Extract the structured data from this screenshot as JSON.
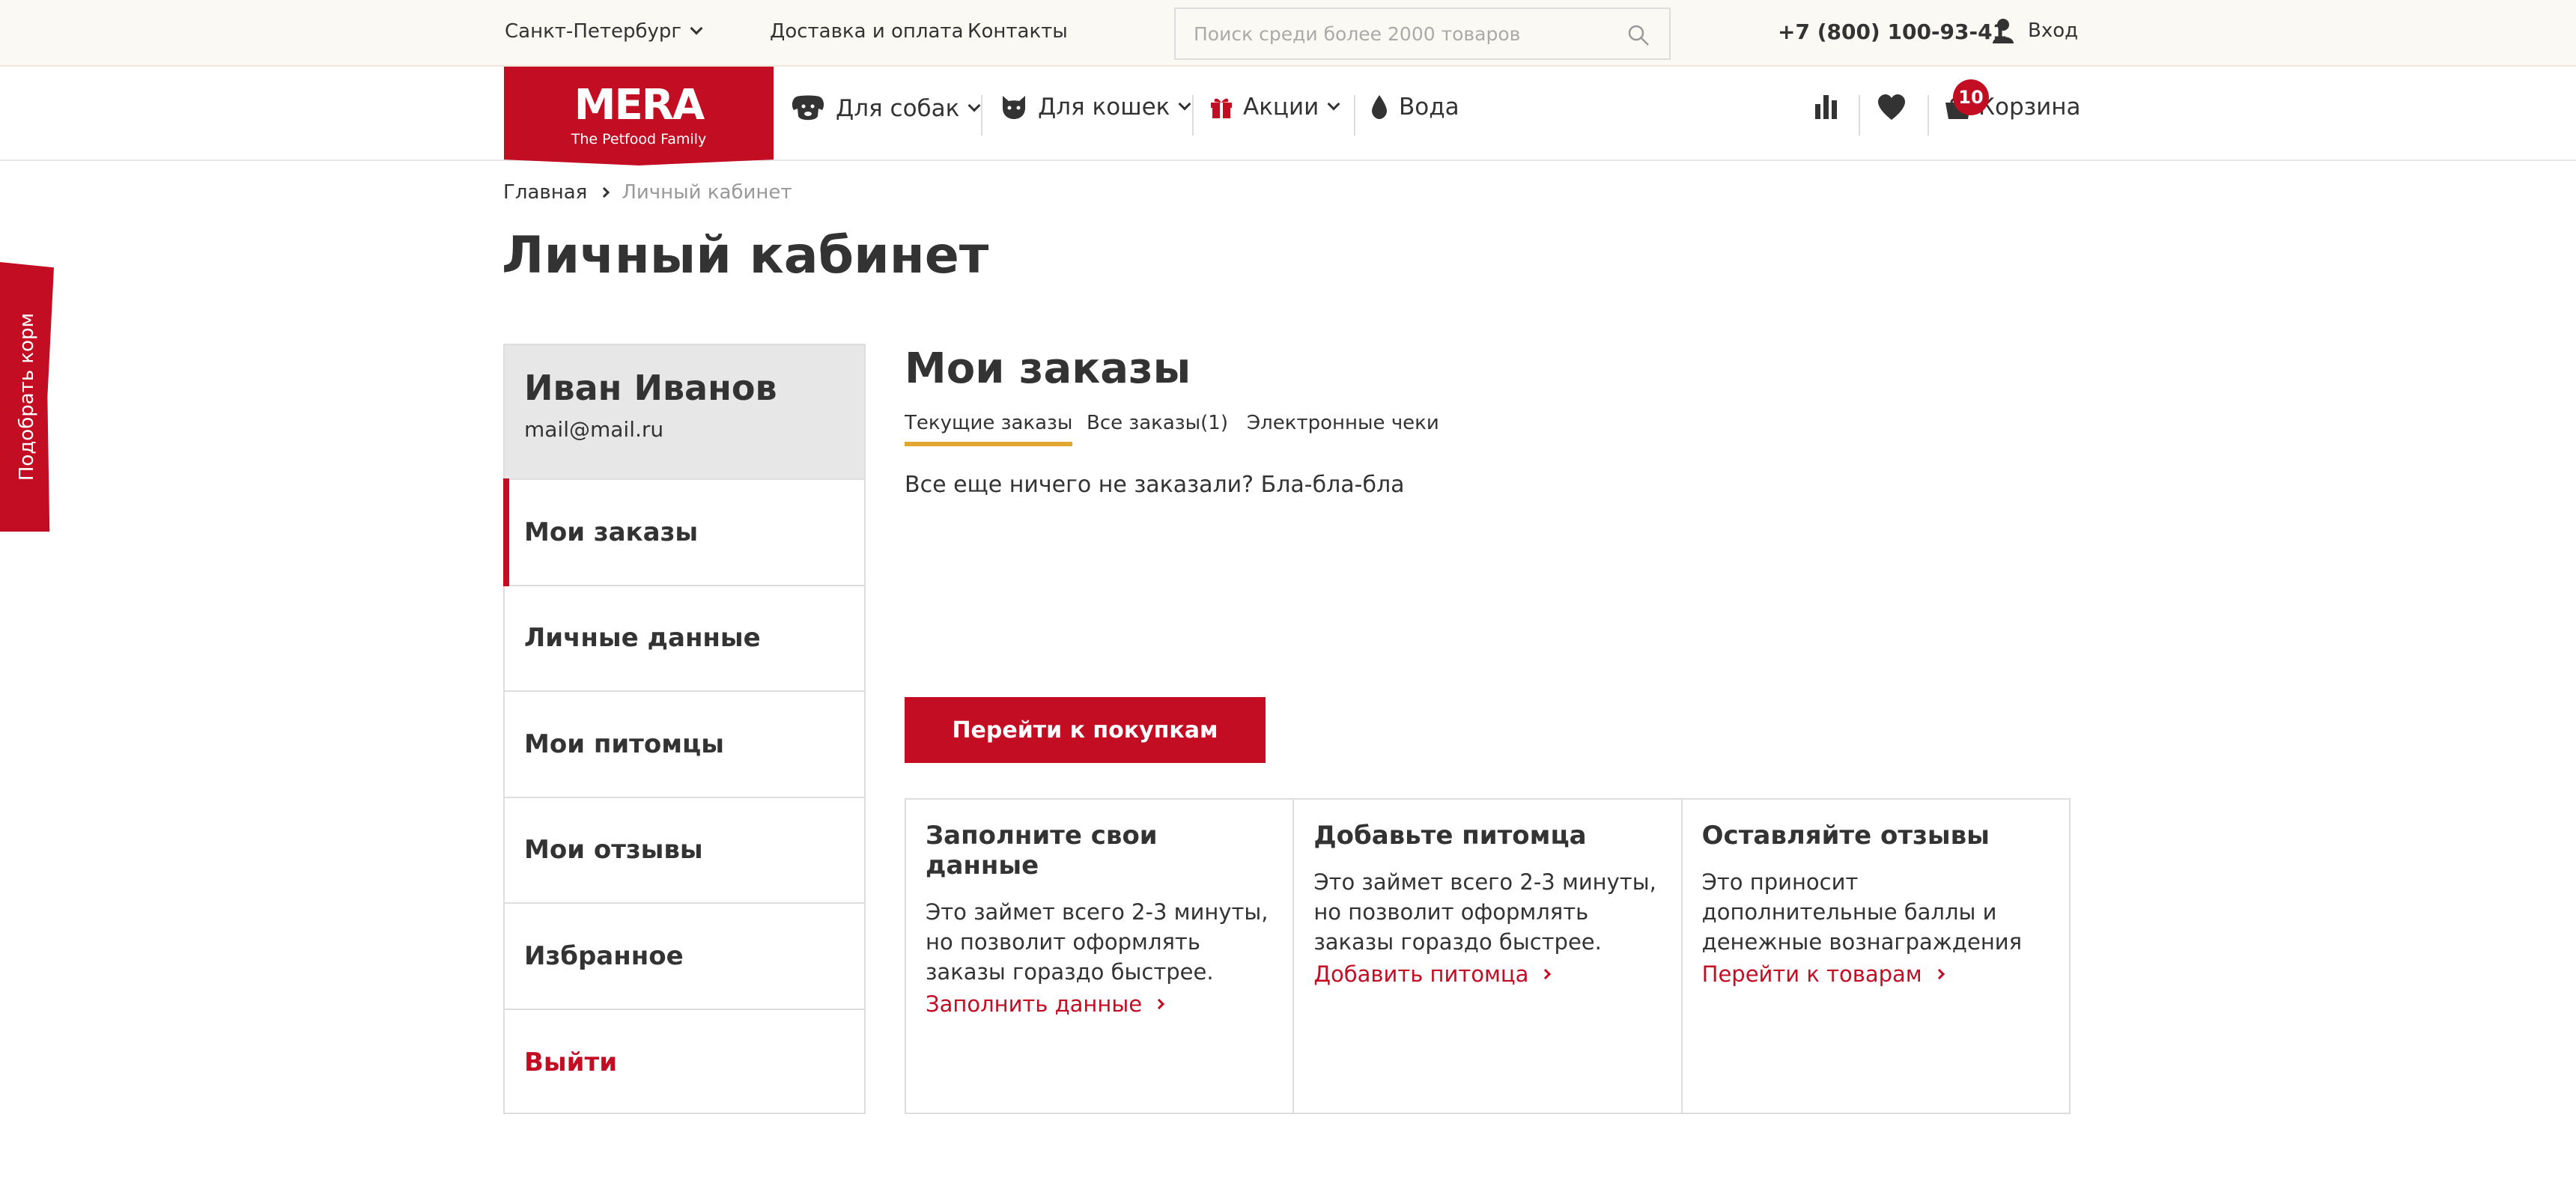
{
  "topbar": {
    "city": "Санкт-Петербург",
    "links": [
      "Доставка и оплата",
      "Контакты"
    ],
    "search_placeholder": "Поиск среди более 2000 товаров",
    "phone": "+7 (800) 100-93-41",
    "login": "Вход"
  },
  "brand": {
    "logo": "MERA",
    "tagline": "The Petfood Family",
    "color": "#c30d23"
  },
  "nav": {
    "items": [
      {
        "label": "Для собак",
        "icon": "dog-icon"
      },
      {
        "label": "Для кошек",
        "icon": "cat-icon"
      },
      {
        "label": "Акции",
        "icon": "gift-icon"
      },
      {
        "label": "Вода",
        "icon": "drop-icon"
      }
    ],
    "cart_label": "Корзина",
    "cart_count": "10"
  },
  "breadcrumb": {
    "home": "Главная",
    "current": "Личный кабинет"
  },
  "page_title": "Личный кабинет",
  "sidetab": "Подобрать корм",
  "profile": {
    "name": "Иван Иванов",
    "email": "mail@mail.ru",
    "menu": [
      "Мои заказы",
      "Личные данные",
      "Мои питомцы",
      "Мои отзывы",
      "Избранное",
      "Выйти"
    ]
  },
  "main": {
    "title": "Мои заказы",
    "tabs": [
      "Текущие заказы",
      "Все заказы(1)",
      "Электронные чеки"
    ],
    "empty_text": "Все еще ничего не заказали? Бла-бла-бла",
    "cta": "Перейти к покупкам"
  },
  "cards": [
    {
      "title": "Заполните свои данные",
      "text": "Это займет всего 2-3 минуты, но позволит оформлять заказы гораздо быстрее.",
      "link": "Заполнить данные"
    },
    {
      "title": "Добавьте питомца",
      "text": "Это займет всего 2-3 минуты, но позволит оформлять заказы гораздо быстрее.",
      "link": "Добавить питомца"
    },
    {
      "title": "Оставляйте отзывы",
      "text": "Это приносит дополнительные баллы и денежные вознаграждения",
      "link": "Перейти к товарам"
    }
  ]
}
